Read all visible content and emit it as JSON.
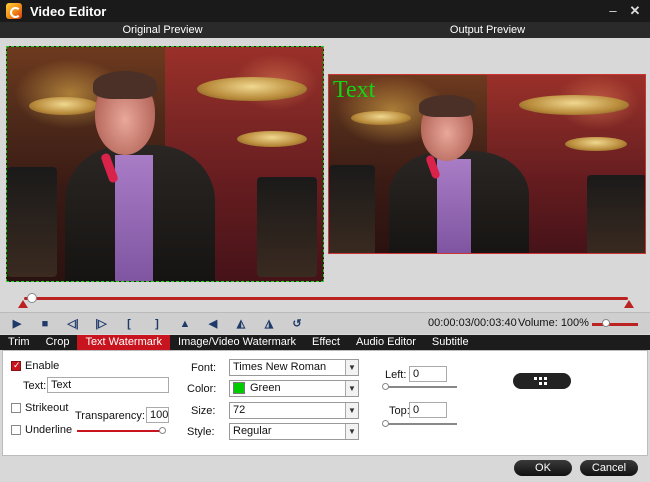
{
  "window": {
    "title": "Video Editor",
    "icon": "app-logo-icon"
  },
  "preview": {
    "original_label": "Original Preview",
    "output_label": "Output Preview",
    "watermark_text": "Text",
    "watermark_color": "#14d414"
  },
  "timeline": {
    "position_fraction": 0.0
  },
  "controls": {
    "icons": [
      "play-icon",
      "stop-icon",
      "prev-frame-icon",
      "next-frame-icon",
      "mark-in-icon",
      "mark-out-icon",
      "flip-icon",
      "rotate-left-icon",
      "flip-horizontal-icon",
      "flip-vertical-icon",
      "undo-icon"
    ],
    "time": "00:00:03/00:03:40",
    "volume_label": "Volume:",
    "volume_value": "100%"
  },
  "tabs": [
    "Trim",
    "Crop",
    "Text Watermark",
    "Image/Video Watermark",
    "Effect",
    "Audio Editor",
    "Subtitle"
  ],
  "active_tab": "Text Watermark",
  "settings": {
    "enable_label": "Enable",
    "enable_checked": true,
    "text_label": "Text:",
    "text_value": "Text",
    "strikeout_label": "Strikeout",
    "underline_label": "Underline",
    "transparency_label": "Transparency:",
    "transparency_value": "100",
    "font_label": "Font:",
    "font_value": "Times New Roman",
    "color_label": "Color:",
    "color_value": "Green",
    "color_hex": "#00cc00",
    "size_label": "Size:",
    "size_value": "72",
    "style_label": "Style:",
    "style_value": "Regular",
    "left_label": "Left:",
    "left_value": "0",
    "top_label": "Top:",
    "top_value": "0"
  },
  "footer": {
    "ok_label": "OK",
    "cancel_label": "Cancel"
  },
  "accent": "#c8141e"
}
